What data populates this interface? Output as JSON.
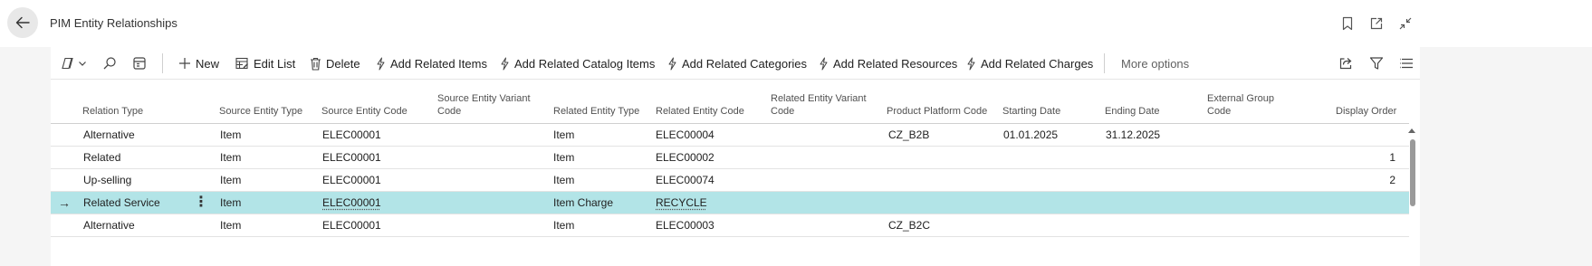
{
  "header": {
    "title": "PIM Entity Relationships",
    "icons": [
      "back-arrow-icon",
      "bookmark-icon",
      "open-in-new-window-icon",
      "collapse-icon"
    ]
  },
  "actionbar": {
    "icons_left": [
      "views-icon",
      "chevron-down-icon",
      "search-icon",
      "layout-icon"
    ],
    "new_label": "New",
    "edit_list_label": "Edit List",
    "delete_label": "Delete",
    "add_related_items_label": "Add Related Items",
    "add_related_catalog_items_label": "Add Related Catalog Items",
    "add_related_categories_label": "Add Related Categories",
    "add_related_resources_label": "Add Related Resources",
    "add_related_charges_label": "Add Related Charges",
    "more_options_label": "More options",
    "icons_right": [
      "share-icon",
      "filter-icon",
      "list-view-icon"
    ]
  },
  "table": {
    "columns": {
      "relation_type": "Relation Type",
      "source_entity_type": "Source Entity Type",
      "source_entity_code": "Source Entity Code",
      "source_entity_variant_code_1": "Source Entity Variant",
      "source_entity_variant_code_2": "Code",
      "related_entity_type": "Related Entity Type",
      "related_entity_code": "Related Entity Code",
      "related_entity_variant_code_1": "Related Entity Variant",
      "related_entity_variant_code_2": "Code",
      "product_platform_code": "Product Platform Code",
      "starting_date": "Starting Date",
      "ending_date": "Ending Date",
      "external_group_code_1": "External Group",
      "external_group_code_2": "Code",
      "display_order": "Display Order"
    },
    "rows": [
      {
        "relation_type": "Alternative",
        "source_entity_type": "Item",
        "source_entity_code": "ELEC00001",
        "related_entity_type": "Item",
        "related_entity_code": "ELEC00004",
        "product_platform_code": "CZ_B2B",
        "starting_date": "01.01.2025",
        "ending_date": "31.12.2025",
        "display_order": ""
      },
      {
        "relation_type": "Related",
        "source_entity_type": "Item",
        "source_entity_code": "ELEC00001",
        "related_entity_type": "Item",
        "related_entity_code": "ELEC00002",
        "product_platform_code": "",
        "starting_date": "",
        "ending_date": "",
        "display_order": "1"
      },
      {
        "relation_type": "Up-selling",
        "source_entity_type": "Item",
        "source_entity_code": "ELEC00001",
        "related_entity_type": "Item",
        "related_entity_code": "ELEC00074",
        "product_platform_code": "",
        "starting_date": "",
        "ending_date": "",
        "display_order": "2"
      },
      {
        "relation_type": "Related Service",
        "source_entity_type": "Item",
        "source_entity_code": "ELEC00001",
        "related_entity_type": "Item Charge",
        "related_entity_code": "RECYCLE",
        "product_platform_code": "",
        "starting_date": "",
        "ending_date": "",
        "display_order": ""
      },
      {
        "relation_type": "Alternative",
        "source_entity_type": "Item",
        "source_entity_code": "ELEC00001",
        "related_entity_type": "Item",
        "related_entity_code": "ELEC00003",
        "product_platform_code": "CZ_B2C",
        "starting_date": "",
        "ending_date": "",
        "display_order": ""
      }
    ],
    "selected_row": 3,
    "row_arrow": "→",
    "row_menu": "⋮"
  },
  "colors": {
    "selected_row": "#b2e4e7",
    "accent": "#0f6cbd"
  }
}
